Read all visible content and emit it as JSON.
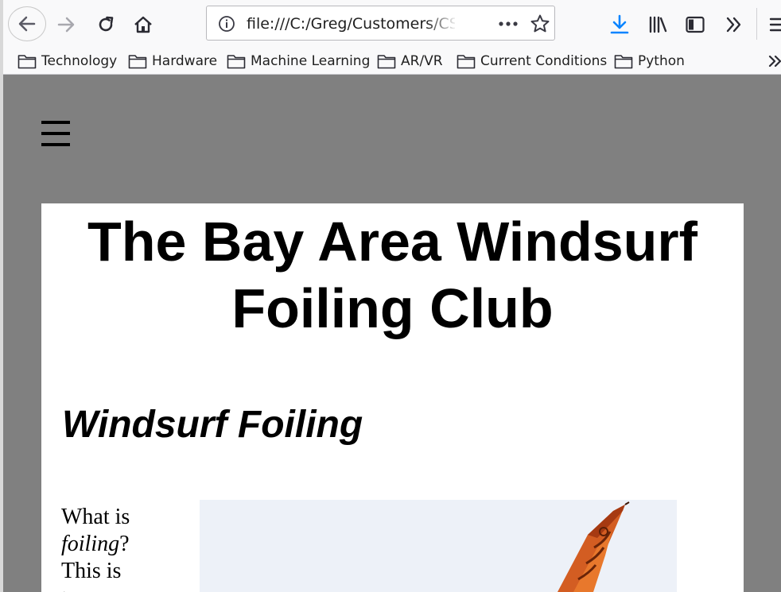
{
  "browser": {
    "url": "file:///C:/Greg/Customers/CS",
    "icons": {
      "back": "back-arrow-icon",
      "forward": "forward-arrow-icon",
      "reload": "reload-icon",
      "home": "home-icon",
      "site_info": "info-icon",
      "page_actions": "more-icon",
      "bookmark_star": "star-icon",
      "downloads": "download-icon",
      "library": "library-icon",
      "sidebar": "sidebar-icon",
      "overflow": "chevrons-right-icon",
      "menu": "menu-icon"
    },
    "colors": {
      "download_accent": "#0a84ff",
      "toolbar_bg": "#f9f9fa"
    }
  },
  "bookmarks": [
    {
      "label": "Technology"
    },
    {
      "label": "Hardware"
    },
    {
      "label": "Machine Learning"
    },
    {
      "label": "AR/VR"
    },
    {
      "label": "Current Conditions"
    },
    {
      "label": "Python"
    }
  ],
  "page": {
    "background": "#808080",
    "nav_icon": "hamburger-menu-icon",
    "title": "The Bay Area Windsurf Foiling Club",
    "section_heading": "Windsurf Foiling",
    "intro": {
      "line1": "What is",
      "emphasis": "foiling",
      "line2_rest": "?",
      "line3": "This is",
      "line4": "t"
    },
    "image_subject": "windsurf-sail-photo"
  }
}
